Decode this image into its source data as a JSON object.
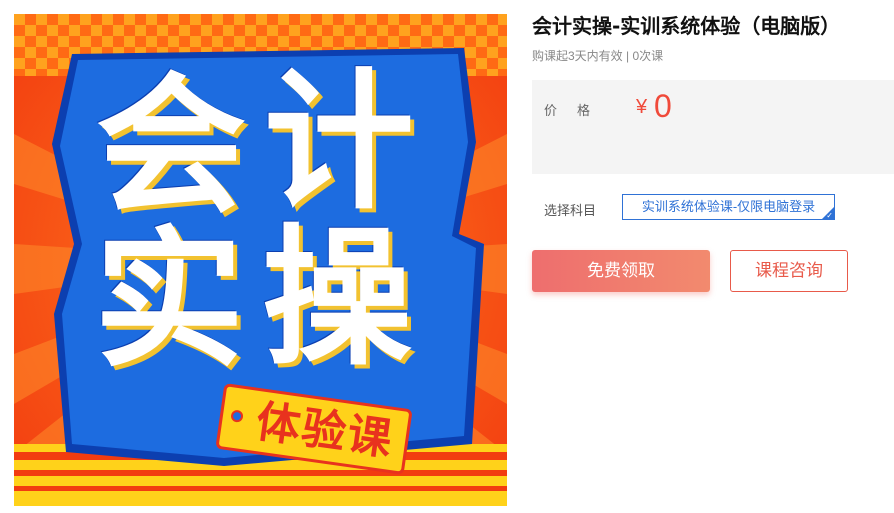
{
  "cover": {
    "chars": [
      "会",
      "计",
      "实",
      "操"
    ],
    "tag_text": "体验课",
    "colors": {
      "background": "#ff5a14",
      "panel": "#1d6ce0",
      "tag": "#ffd21a",
      "checker": "#ff9a1a"
    }
  },
  "course": {
    "title": "会计实操-实训系统体验（电脑版）",
    "meta": "购课起3天内有效 | 0次课"
  },
  "price": {
    "label": "价格",
    "symbol": "¥",
    "value": "0"
  },
  "subject": {
    "label": "选择科目",
    "selected_option": "实训系统体验课-仅限电脑登录"
  },
  "actions": {
    "free_label": "免费领取",
    "consult_label": "课程咨询"
  },
  "colors": {
    "accent_red": "#f04a3a",
    "accent_blue": "#2f72d6"
  }
}
